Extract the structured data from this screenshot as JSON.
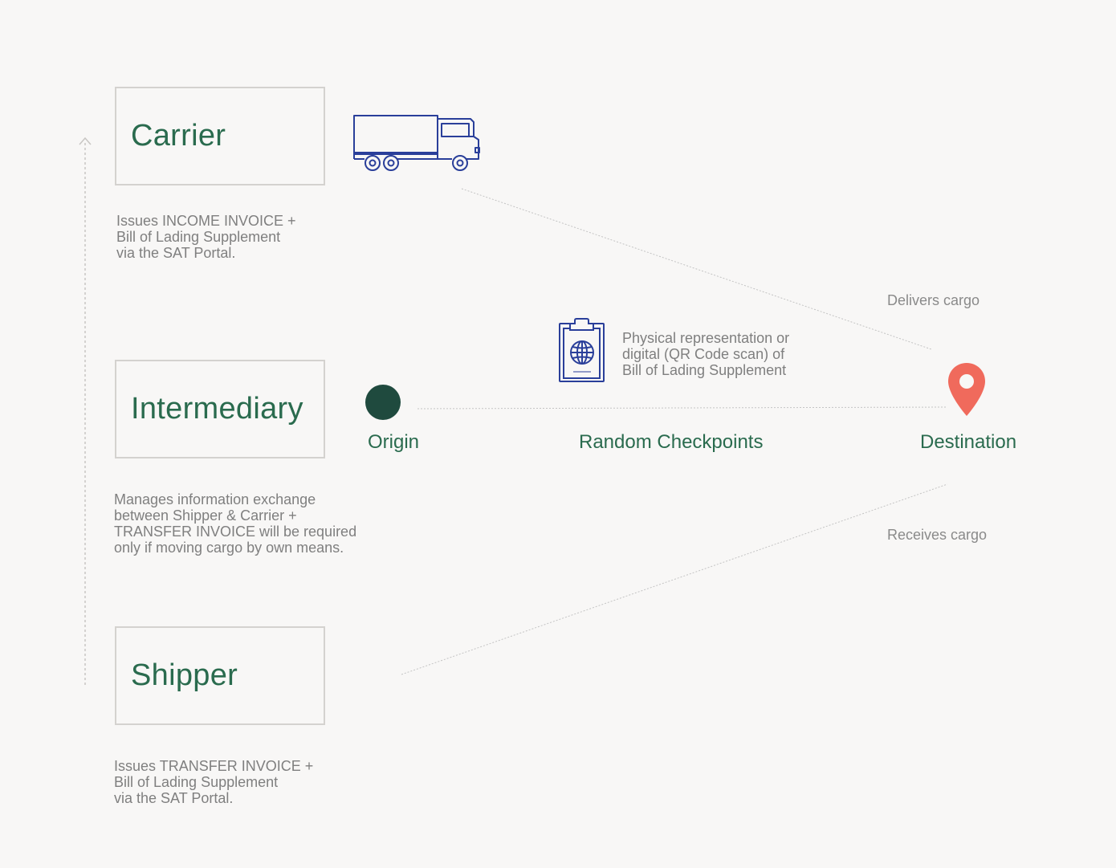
{
  "roles": [
    {
      "id": "carrier",
      "title": "Carrier",
      "description": "Issues INCOME INVOICE +\nBill of Lading Supplement\nvia the SAT Portal."
    },
    {
      "id": "intermediary",
      "title": "Intermediary",
      "description": "Manages information exchange\nbetween Shipper & Carrier +\nTRANSFER INVOICE will be required\nonly if moving cargo by own means."
    },
    {
      "id": "shipper",
      "title": "Shipper",
      "description": "Issues TRANSFER INVOICE +\nBill of Lading Supplement\nvia the SAT Portal."
    }
  ],
  "flow": {
    "origin_label": "Origin",
    "checkpoints_label": "Random Checkpoints",
    "destination_label": "Destination",
    "delivers_label": "Delivers cargo",
    "receives_label": "Receives cargo",
    "document_note": "Physical representation or\ndigital (QR Code scan) of\nBill of Lading Supplement"
  },
  "icons": {
    "truck": "truck-icon",
    "document": "passport-document-icon",
    "origin": "origin-dot-icon",
    "destination": "location-pin-icon",
    "arrow": "arrow-up-icon"
  },
  "colors": {
    "accent_green": "#2a6b4e",
    "origin_dot": "#1f4a3e",
    "pin": "#f06a5c",
    "icon_blue": "#2a3f9a",
    "muted_text": "#7f7f7f",
    "box_border": "#d4d2cf",
    "background": "#f8f7f6"
  }
}
